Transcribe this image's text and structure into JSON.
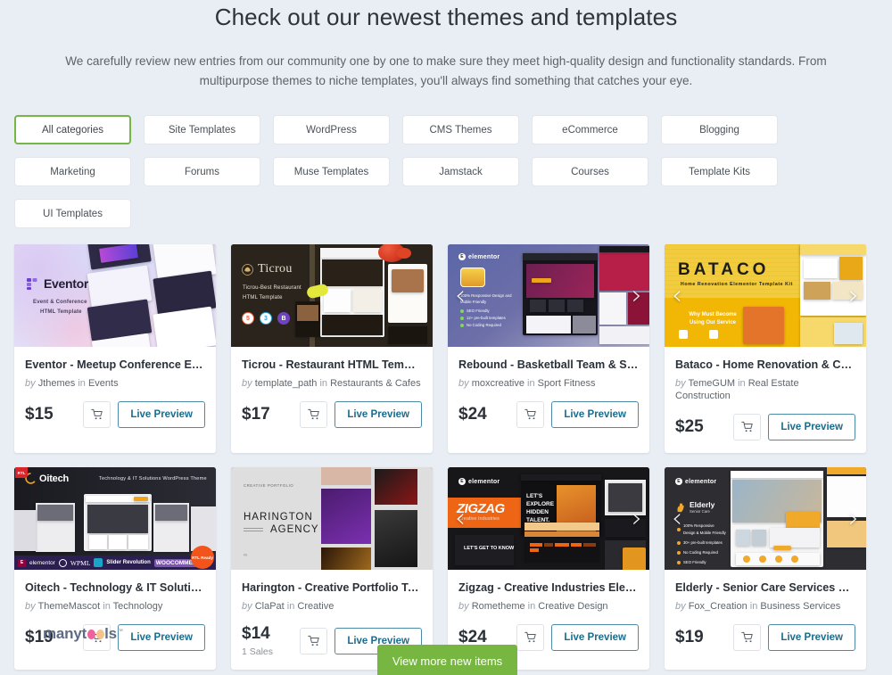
{
  "header": {
    "title": "Check out our newest themes and templates",
    "subtitle": "We carefully review new entries from our community one by one to make sure they meet high-quality design and functionality standards. From multipurpose themes to niche templates, you'll always find something that catches your eye."
  },
  "categories": [
    {
      "label": "All categories",
      "active": true
    },
    {
      "label": "Site Templates",
      "active": false
    },
    {
      "label": "WordPress",
      "active": false
    },
    {
      "label": "CMS Themes",
      "active": false
    },
    {
      "label": "eCommerce",
      "active": false
    },
    {
      "label": "Blogging",
      "active": false
    },
    {
      "label": "Marketing",
      "active": false
    },
    {
      "label": "Forums",
      "active": false
    },
    {
      "label": "Muse Templates",
      "active": false
    },
    {
      "label": "Jamstack",
      "active": false
    },
    {
      "label": "Courses",
      "active": false
    },
    {
      "label": "Template Kits",
      "active": false
    },
    {
      "label": "UI Templates",
      "active": false
    }
  ],
  "common": {
    "by_label": "by",
    "in_label": "in",
    "preview_label": "Live Preview",
    "cart_icon": "shopping-cart-icon",
    "prev_icon": "chevron-left-icon",
    "next_icon": "chevron-right-icon"
  },
  "cards": [
    {
      "title": "Eventor - Meetup Conference Expo ...",
      "author": "Jthemes",
      "category": "Events",
      "price": "$15",
      "sales": "",
      "arrows": false,
      "thumb": {
        "brand": "Eventor",
        "tagline_1": "Event & Conference",
        "tagline_2": "HTML Template"
      }
    },
    {
      "title": "Ticrou - Restaurant HTML Template",
      "author": "template_path",
      "category": "Restaurants & Cafes",
      "price": "$17",
      "sales": "",
      "arrows": false,
      "thumb": {
        "brand": "Ticrou",
        "tagline_1": "Ticrou-Best Restaurant",
        "tagline_2": "HTML Template"
      }
    },
    {
      "title": "Rebound - Basketball Team & Spor...",
      "author": "moxcreative",
      "category": "Sport Fitness",
      "price": "$24",
      "sales": "",
      "arrows": true,
      "thumb": {
        "brand": "elementor",
        "bullets": [
          "100% Responsive Design and Mobile Friendly",
          "SEO Friendly",
          "12+ pre-built templates",
          "No Coding Required"
        ]
      }
    },
    {
      "title": "Bataco - Home Renovation & Const...",
      "author": "TemeGUM",
      "category": "Real Estate Construction",
      "price": "$25",
      "sales": "",
      "arrows": true,
      "thumb": {
        "brand": "BATACO",
        "tagline_1": "Home Renovation Elementor Template Kit",
        "tagline_2": "Why Must Become Using Our Service"
      }
    },
    {
      "title": "Oitech - Technology & IT Solutions ...",
      "author": "ThemeMascot",
      "category": "Technology",
      "price": "$19",
      "sales": "",
      "arrows": false,
      "thumb": {
        "brand": "Oitech",
        "tagline_1": "Technology & IT Solutions WordPress Theme",
        "badges": [
          "elementor",
          "WPML",
          "Slider Revolution",
          "WOOCOMMERCE",
          "RTL Ready"
        ]
      }
    },
    {
      "title": "Harington - Creative Portfolio Tem...",
      "author": "ClaPat",
      "category": "Creative",
      "price": "$14",
      "sales": "1 Sales",
      "arrows": false,
      "thumb": {
        "brand": "HARINGTON",
        "tagline_1": "CREATIVE PORTFOLIO",
        "tagline_2": "AGENCY"
      }
    },
    {
      "title": "Zigzag - Creative Industries Elemen...",
      "author": "Rometheme",
      "category": "Creative Design",
      "price": "$24",
      "sales": "",
      "arrows": true,
      "thumb": {
        "brand": "ZIGZAG",
        "tagline_1": "Creative Industries",
        "tagline_2": "LET'S EXPLORE HIDDEN TALENT."
      }
    },
    {
      "title": "Elderly - Senior Care Services Eleme...",
      "author": "Fox_Creation",
      "category": "Business Services",
      "price": "$19",
      "sales": "",
      "arrows": true,
      "thumb": {
        "brand": "Elderly",
        "tagline_1": "Senior Care",
        "bullets": [
          "100% Responsive Design & Mobile Friendly",
          "30+ pre-built templates",
          "No Coding Required",
          "SEO Friendly"
        ]
      }
    }
  ],
  "footer": {
    "logo_prefix": "manyt",
    "logo_suffix": "ls",
    "logo_tm": "™",
    "view_more_label": "View more new items"
  },
  "colors": {
    "page_bg": "#e9edf4",
    "accent_green": "#76b641",
    "preview_blue": "#1a6d8f",
    "active_chip_border": "#76b645"
  }
}
